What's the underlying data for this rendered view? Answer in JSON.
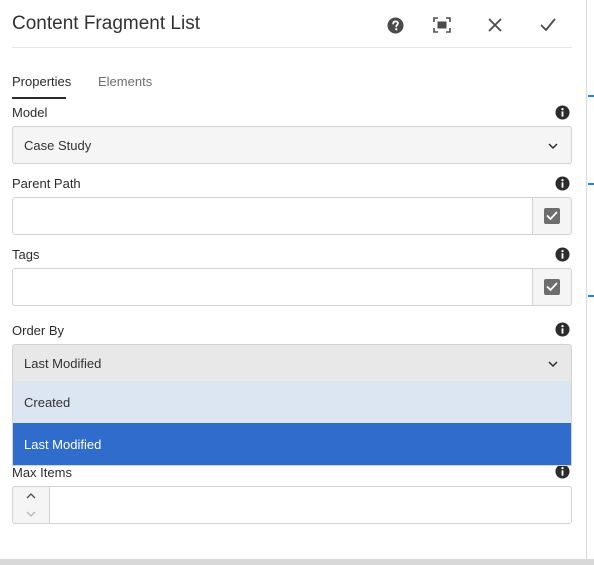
{
  "dialog": {
    "title": "Content Fragment List",
    "header_icons": [
      "help-icon",
      "fullscreen-icon",
      "close-icon",
      "checkmark-icon"
    ]
  },
  "tabs": [
    {
      "label": "Properties",
      "active": true
    },
    {
      "label": "Elements",
      "active": false
    }
  ],
  "fields": {
    "model": {
      "label": "Model",
      "value": "Case Study"
    },
    "parent_path": {
      "label": "Parent Path",
      "value": ""
    },
    "tags": {
      "label": "Tags",
      "value": ""
    },
    "order_by": {
      "label": "Order By",
      "value": "Last Modified",
      "options": [
        {
          "label": "Created",
          "state": "hover"
        },
        {
          "label": "Last Modified",
          "state": "selected"
        }
      ]
    },
    "max_items": {
      "label": "Max Items",
      "value": ""
    }
  },
  "colors": {
    "accent": "#2f6ccc",
    "hover": "#dce6f3",
    "background_line": "#2680eb"
  }
}
